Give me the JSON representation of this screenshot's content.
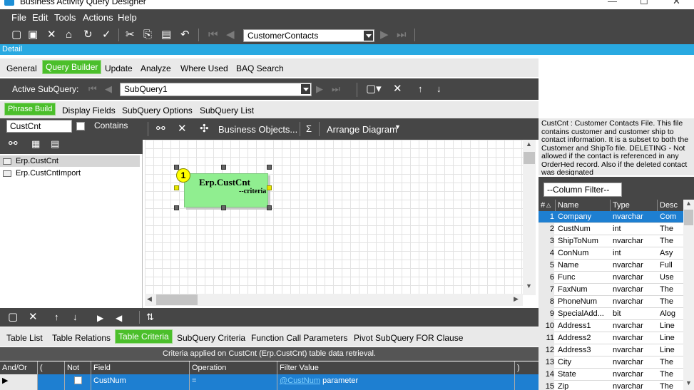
{
  "window": {
    "title": "Business Activity Query Designer",
    "minimize": "—",
    "maximize": "☐",
    "close": "✕"
  },
  "menu": [
    "File",
    "Edit",
    "Tools",
    "Actions",
    "Help"
  ],
  "toolbar": {
    "query_combo": "CustomerContacts"
  },
  "detail_label": "Detail",
  "tabs_main": [
    {
      "label": "General"
    },
    {
      "label": "Query Builder",
      "active": true
    },
    {
      "label": "Update"
    },
    {
      "label": "Analyze"
    },
    {
      "label": "Where Used"
    },
    {
      "label": "BAQ Search"
    }
  ],
  "subquery": {
    "label": "Active SubQuery:",
    "value": "SubQuery1"
  },
  "tabs_sub": [
    {
      "label": "Phrase Build",
      "active": true
    },
    {
      "label": "Display Fields"
    },
    {
      "label": "SubQuery Options"
    },
    {
      "label": "SubQuery List"
    }
  ],
  "search": {
    "value": "CustCnt",
    "contains_label": "Contains"
  },
  "tables": [
    "Erp.CustCnt",
    "Erp.CustCntImport"
  ],
  "diagram": {
    "business_objects": "Business Objects...",
    "sigma": "Σ",
    "arrange": "Arrange Diagram",
    "node_title": "Erp.CustCnt",
    "node_sub": "--criteria",
    "node_badge": "1"
  },
  "tabs_bottom": [
    {
      "label": "Table List"
    },
    {
      "label": "Table Relations"
    },
    {
      "label": "Table Criteria",
      "active": true
    },
    {
      "label": "SubQuery Criteria"
    },
    {
      "label": "Function Call Parameters"
    },
    {
      "label": "Pivot SubQuery FOR Clause"
    }
  ],
  "criteria_banner": "Criteria applied on CustCnt (Erp.CustCnt) table data retrieval.",
  "criteria_grid": {
    "headers": [
      "And/Or",
      "(",
      "Not",
      "Field",
      "Operation",
      "Filter Value",
      ")"
    ],
    "row": {
      "field": "CustNum",
      "operation": "=",
      "filter_link": "@CustNum",
      "filter_rest": "parameter"
    }
  },
  "description": "CustCnt : Customer Contacts File. This file contains customer and customer ship to contact information. It is a subset to both the Customer and ShipTo file. DELETING - Not allowed if the contact is referenced in any OrderHed record. Also if the deleted contact was designated",
  "column_filter": "--Column Filter--",
  "columns": {
    "headers": [
      "#",
      "Name",
      "Type",
      "Desc"
    ],
    "rows": [
      {
        "n": "1",
        "name": "Company",
        "type": "nvarchar",
        "desc": "Com"
      },
      {
        "n": "2",
        "name": "CustNum",
        "type": "int",
        "desc": "The"
      },
      {
        "n": "3",
        "name": "ShipToNum",
        "type": "nvarchar",
        "desc": "The"
      },
      {
        "n": "4",
        "name": "ConNum",
        "type": "int",
        "desc": "Asy"
      },
      {
        "n": "5",
        "name": "Name",
        "type": "nvarchar",
        "desc": "Full"
      },
      {
        "n": "6",
        "name": "Func",
        "type": "nvarchar",
        "desc": "Use"
      },
      {
        "n": "7",
        "name": "FaxNum",
        "type": "nvarchar",
        "desc": "The"
      },
      {
        "n": "8",
        "name": "PhoneNum",
        "type": "nvarchar",
        "desc": "The"
      },
      {
        "n": "9",
        "name": "SpecialAdd...",
        "type": "bit",
        "desc": "Alog"
      },
      {
        "n": "10",
        "name": "Address1",
        "type": "nvarchar",
        "desc": "Line"
      },
      {
        "n": "11",
        "name": "Address2",
        "type": "nvarchar",
        "desc": "Line"
      },
      {
        "n": "12",
        "name": "Address3",
        "type": "nvarchar",
        "desc": "Line"
      },
      {
        "n": "13",
        "name": "City",
        "type": "nvarchar",
        "desc": "The"
      },
      {
        "n": "14",
        "name": "State",
        "type": "nvarchar",
        "desc": "The"
      },
      {
        "n": "15",
        "name": "Zip",
        "type": "nvarchar",
        "desc": "The"
      }
    ]
  }
}
